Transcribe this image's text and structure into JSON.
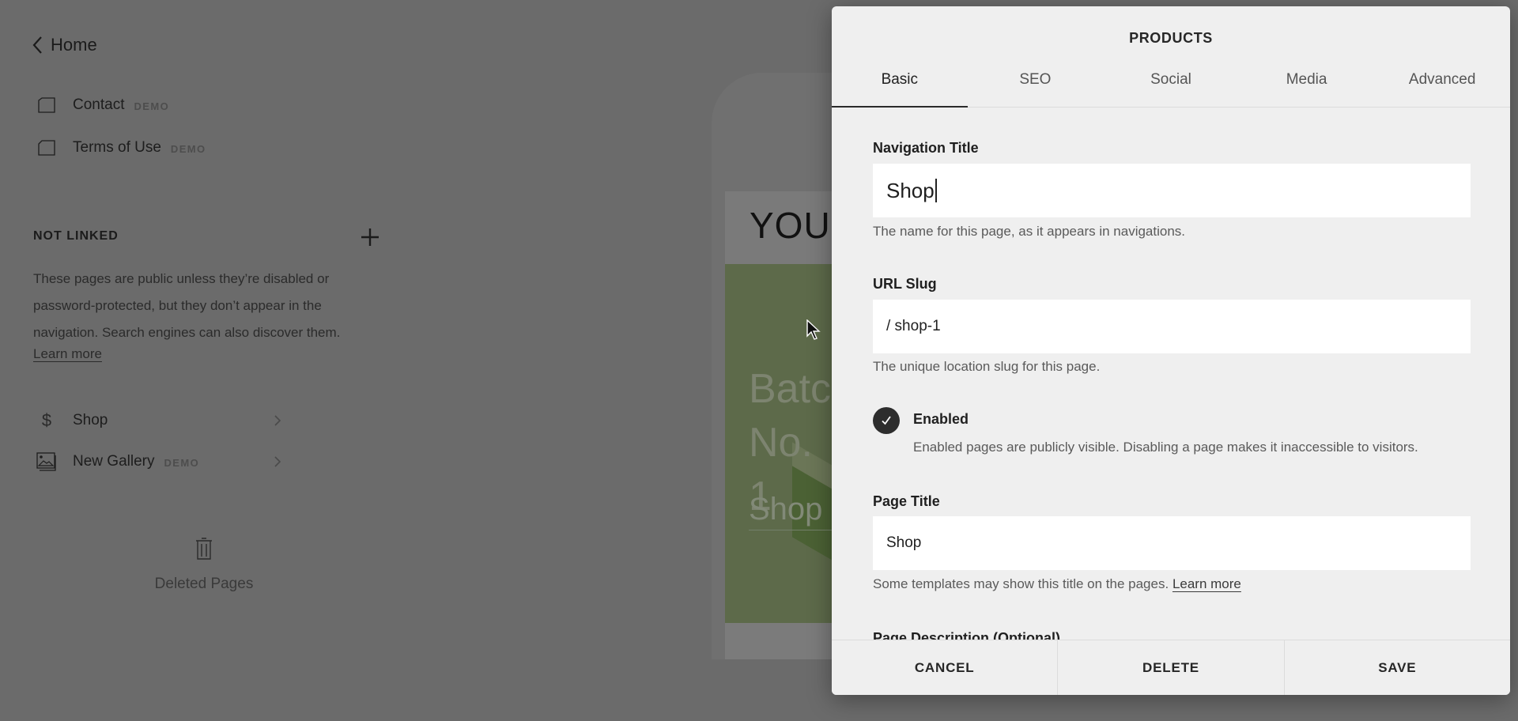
{
  "sidebar": {
    "back_label": "Home",
    "linked_items": [
      {
        "label": "Contact",
        "badge": "DEMO",
        "icon": "page-icon"
      },
      {
        "label": "Terms of Use",
        "badge": "DEMO",
        "icon": "page-icon"
      }
    ],
    "not_linked": {
      "header": "NOT LINKED",
      "description": "These pages are public unless they’re disabled or password-protected, but they don’t appear in the navigation. Search engines can also discover them.",
      "learn_more": "Learn more",
      "items": [
        {
          "label": "Shop",
          "badge": "",
          "icon": "dollar-icon"
        },
        {
          "label": "New Gallery",
          "badge": "DEMO",
          "icon": "gallery-icon"
        }
      ]
    },
    "deleted_pages": "Deleted Pages"
  },
  "preview": {
    "brand_text": "YOUR",
    "hero_line1": "Batc",
    "hero_line2": "No. 1",
    "hero_cta": "Shop"
  },
  "modal": {
    "title": "PRODUCTS",
    "tabs": [
      {
        "label": "Basic",
        "active": true
      },
      {
        "label": "SEO",
        "active": false
      },
      {
        "label": "Social",
        "active": false
      },
      {
        "label": "Media",
        "active": false
      },
      {
        "label": "Advanced",
        "active": false
      }
    ],
    "navigation_title": {
      "label": "Navigation Title",
      "value": "Shop",
      "help": "The name for this page, as it appears in navigations."
    },
    "url_slug": {
      "label": "URL Slug",
      "value": "/ shop-1",
      "help": "The unique location slug for this page."
    },
    "enabled": {
      "label": "Enabled",
      "checked": true,
      "help": "Enabled pages are publicly visible. Disabling a page makes it inaccessible to visitors."
    },
    "page_title": {
      "label": "Page Title",
      "value": "Shop",
      "help": "Some templates may show this title on the pages.",
      "learn_more": "Learn more"
    },
    "page_description": {
      "label": "Page Description (Optional)"
    },
    "buttons": {
      "cancel": "CANCEL",
      "delete": "DELETE",
      "save": "SAVE"
    }
  },
  "colors": {
    "overlay_bg": "#6b6b6b",
    "modal_bg": "#efefef",
    "checkbox_fill": "#2d2d2d"
  }
}
